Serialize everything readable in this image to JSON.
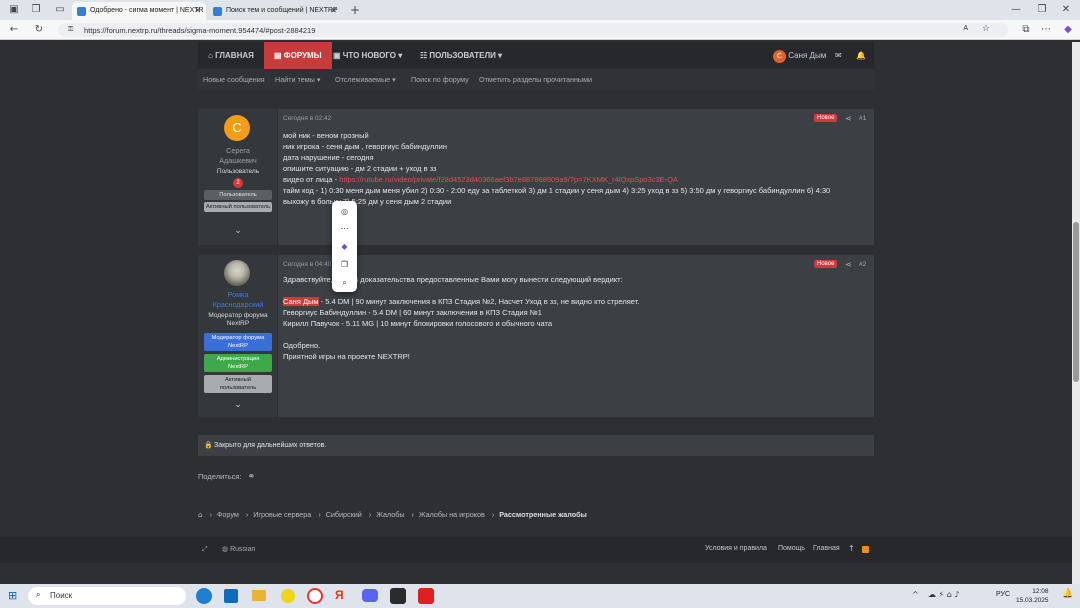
{
  "browser": {
    "tabs": [
      {
        "title": "Одобрено - сигма момент | NEXTR"
      },
      {
        "title": "Поиск тем и сообщений | NEXTRP"
      }
    ],
    "url": "https://forum.nextrp.ru/threads/sigma-moment.954474/#post-2884219"
  },
  "nav": {
    "main": "ГЛАВНАЯ",
    "forums": "ФОРУМЫ",
    "whatsnew": "ЧТО НОВОГО",
    "users": "ПОЛЬЗОВАТЕЛИ",
    "user_initial": "С",
    "user_name": "Саня Дым"
  },
  "subnav": [
    "Новые сообщения",
    "Найти темы",
    "Отслеживаемые",
    "Поиск по форуму",
    "Отметить разделы прочитанными"
  ],
  "post1": {
    "avatar_letter": "С",
    "author_line1": "Серега",
    "author_line2": "Адашкевич",
    "title": "Пользователь",
    "badge_count": "2",
    "badges": [
      "Пользователь",
      "Активный пользователь"
    ],
    "date": "Сегодня в 02:42",
    "new_label": "Новое",
    "number": "#1",
    "lines": [
      "мой ник - веном грозный",
      "ник игрока - сеня дым , геворгиус бабиндуллин",
      "дата нарушение - сегодня",
      "опишите ситуацию - дм 2 стадии + уход в зз"
    ],
    "video_label": "видео от лица - ",
    "video_link": "https://rutube.ru/video/private/f28d4523d40366aef3b7e887868509a9/?p=7KXMK_r4lQxpSpo3c3E-QA",
    "timecode_line1": "тайм код - 1) 0:30 меня дым меня убил 2) 0:30 - 2:00 еду за таблеткой 3) дм 1 стадии у сеня дым 4) 3:25 уход в зз 5) 3:50 дм у геворгиус бабиндуллин 6) 4:30",
    "timecode_line2": "выхожу в больку 7) 5:25 дм у сеня дым 2 стадии"
  },
  "post2": {
    "author_line1": "Ромка",
    "author_line2": "Краснодарский",
    "title_line1": "Модератор форума",
    "title_line2": "NextRP",
    "badges": [
      {
        "line1": "Модератор форума",
        "line2": "NextRP"
      },
      {
        "line1": "Администрация",
        "line2": "NextRP"
      },
      {
        "line1": "Активный",
        "line2": "пользователь"
      }
    ],
    "date": "Сегодня в 04:40",
    "new_label": "Новое",
    "number": "#2",
    "intro": "Здравствуйте, изучив доказательства предоставленные Вами могу вынести следующий вердикт:",
    "highlight_name": "Саня Дым",
    "verdict1_rest": " - 5.4 DM | 90 минут заключения в КПЗ Стадия №2, Насчет Уход в зз, не видно кто стреляет.",
    "verdict2": "Геворгиус Бабиндуллин - 5.4 DM | 60 минут заключения в КПЗ Стадия №1",
    "verdict3": "Кирилл Павучок - 5.11 MG | 10 минут блокировки голосового и обычного чата",
    "approved": "Одобрено.",
    "closing": "Приятной игры на проекте NEXTRP!"
  },
  "closed_notice": "Закрыто для дальнейших ответов.",
  "share_label": "Поделиться:",
  "breadcrumbs": [
    "Форум",
    "Игровые сервера",
    "Сибирский",
    "Жалобы",
    "Жалобы на игроков",
    "Рассмотренные жалобы"
  ],
  "footer": {
    "language": "Russian",
    "links": [
      "Условия и правила",
      "Помощь",
      "Главная"
    ]
  },
  "taskbar": {
    "search": "Поиск",
    "lang": "РУС",
    "time": "12:08",
    "date": "15.03.2025"
  },
  "colors": {
    "accent": "#d64545",
    "page_bg": "#2d2f33",
    "post_bg": "#3c3f44",
    "link": "#e05050"
  }
}
